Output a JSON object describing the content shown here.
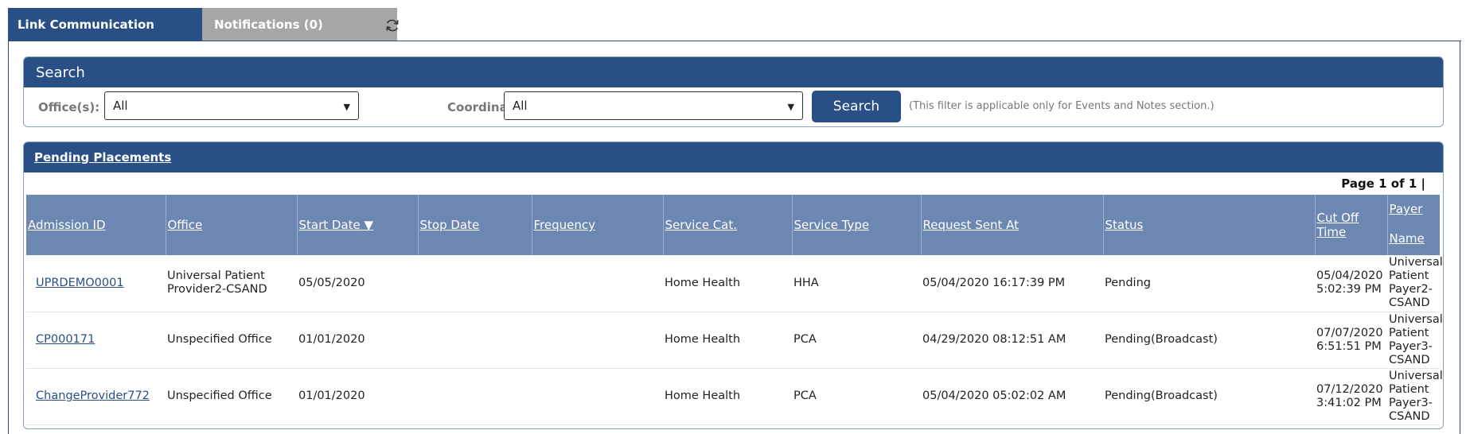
{
  "tabs": [
    {
      "label": "Link Communication"
    },
    {
      "label": "Notifications (0)"
    }
  ],
  "search_panel": {
    "title": "Search",
    "office_label": "Office(s):",
    "office_value": "All",
    "coordinator_label": "Coordina",
    "coordinator_value": "All",
    "search_button": "Search",
    "note": "(This filter is applicable only for Events and Notes section.)"
  },
  "pending_panel": {
    "title": "Pending Placements",
    "pager": "Page 1 of 1 |",
    "columns": [
      "Admission ID",
      "Office",
      "Start Date ▼",
      "Stop Date",
      "Frequency",
      "Service Cat.",
      "Service Type",
      "Request Sent At",
      "Status",
      "Cut Off Time"
    ],
    "payer_column": [
      "Payer",
      "Name"
    ],
    "rows": [
      {
        "admission_id": "UPRDEMO0001",
        "office": [
          "Universal Patient",
          "Provider2-CSAND"
        ],
        "start_date": "05/05/2020",
        "stop_date": "",
        "frequency": "",
        "service_cat": "Home Health",
        "service_type": "HHA",
        "request_sent_at": "05/04/2020 16:17:39 PM",
        "status": "Pending",
        "cut_off_time": [
          "05/04/2020",
          "5:02:39 PM"
        ],
        "payer_name": [
          "Universal",
          "Patient",
          "Payer2-",
          "CSAND"
        ]
      },
      {
        "admission_id": "CP000171",
        "office": [
          "Unspecified Office"
        ],
        "start_date": "01/01/2020",
        "stop_date": "",
        "frequency": "",
        "service_cat": "Home Health",
        "service_type": "PCA",
        "request_sent_at": "04/29/2020 08:12:51 AM",
        "status": "Pending(Broadcast)",
        "cut_off_time": [
          "07/07/2020",
          "6:51:51 PM"
        ],
        "payer_name": [
          "Universal",
          "Patient",
          "Payer3-",
          "CSAND"
        ]
      },
      {
        "admission_id": "ChangeProvider772",
        "office": [
          "Unspecified Office"
        ],
        "start_date": "01/01/2020",
        "stop_date": "",
        "frequency": "",
        "service_cat": "Home Health",
        "service_type": "PCA",
        "request_sent_at": "05/04/2020 05:02:02 AM",
        "status": "Pending(Broadcast)",
        "cut_off_time": [
          "07/12/2020",
          "3:41:02 PM"
        ],
        "payer_name": [
          "Universal",
          "Patient",
          "Payer3-",
          "CSAND"
        ]
      }
    ]
  },
  "icons": {
    "refresh": "refresh-icon",
    "dropdown": "chevron-down-icon"
  },
  "colors": {
    "header_blue": "#284f86",
    "table_header": "#6d87b3",
    "inactive_tab": "#a6a6a6"
  }
}
